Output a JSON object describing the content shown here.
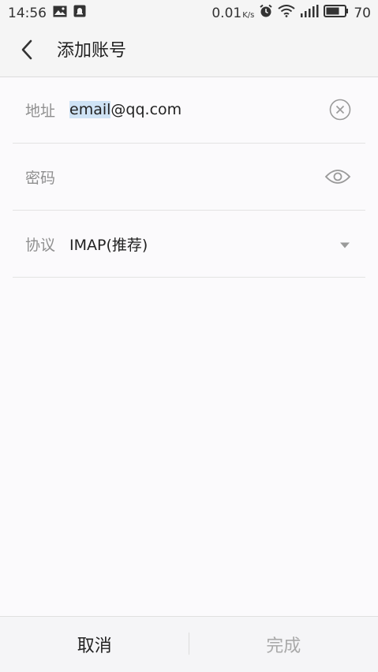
{
  "status_bar": {
    "time": "14:56",
    "speed": "0.01",
    "speed_unit": "K/s",
    "battery": "70",
    "icons": [
      "image-icon",
      "notification-icon",
      "alarm-icon",
      "wifi-icon",
      "signal-icon",
      "battery-icon"
    ]
  },
  "header": {
    "title": "添加账号",
    "back_icon": "chevron-left-icon"
  },
  "form": {
    "address": {
      "label": "地址",
      "value_selected": "email",
      "value_rest": "@qq.com",
      "icon": "clear-icon"
    },
    "password": {
      "label": "密码",
      "value": "",
      "icon": "eye-icon"
    },
    "protocol": {
      "label": "协议",
      "value": "IMAP(推荐)",
      "icon": "dropdown-arrow-icon"
    }
  },
  "footer": {
    "cancel_label": "取消",
    "done_label": "完成"
  },
  "colors": {
    "selection": "#cfe3f5",
    "label": "#8f8f8f",
    "disabled": "#a9a9a9"
  }
}
